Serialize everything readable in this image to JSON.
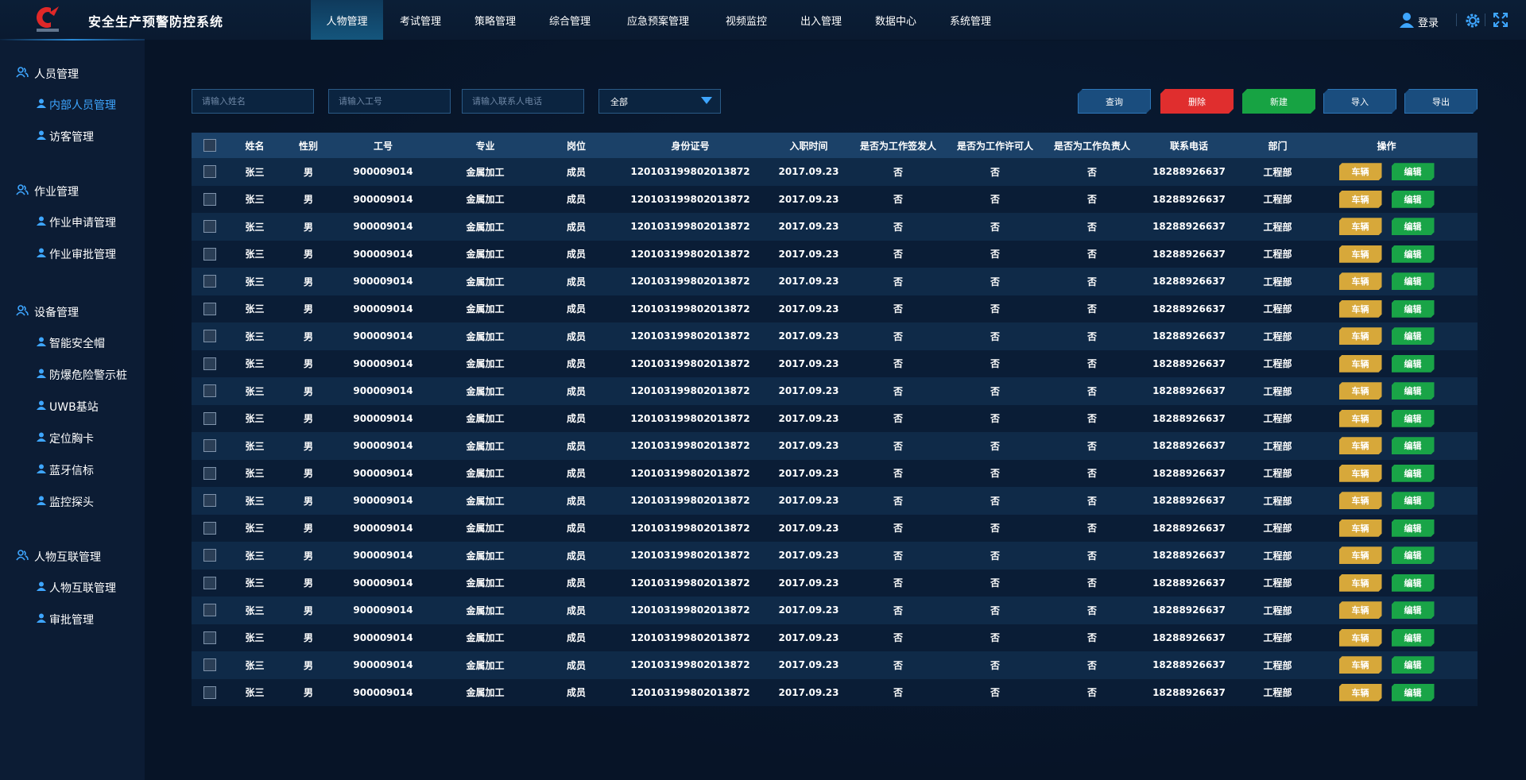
{
  "app": {
    "title": "安全生产预警防控系统"
  },
  "nav": [
    {
      "label": "人物管理",
      "active": true
    },
    {
      "label": "考试管理"
    },
    {
      "label": "策略管理"
    },
    {
      "label": "综合管理"
    },
    {
      "label": "应急预案管理"
    },
    {
      "label": "视频监控"
    },
    {
      "label": "出入管理"
    },
    {
      "label": "数据中心"
    },
    {
      "label": "系统管理"
    }
  ],
  "header": {
    "login_label": "登录"
  },
  "sidebar": {
    "groups": [
      {
        "label": "人员管理",
        "items": [
          {
            "label": "内部人员管理",
            "active": true
          },
          {
            "label": "访客管理"
          }
        ]
      },
      {
        "label": "作业管理",
        "items": [
          {
            "label": "作业申请管理"
          },
          {
            "label": "作业审批管理"
          }
        ]
      },
      {
        "label": "设备管理",
        "items": [
          {
            "label": "智能安全帽"
          },
          {
            "label": "防爆危险警示桩"
          },
          {
            "label": "UWB基站"
          },
          {
            "label": "定位胸卡"
          },
          {
            "label": "蓝牙信标"
          },
          {
            "label": "监控探头"
          }
        ]
      },
      {
        "label": "人物互联管理",
        "items": [
          {
            "label": "人物互联管理"
          },
          {
            "label": "审批管理"
          }
        ]
      }
    ]
  },
  "filters": {
    "name_placeholder": "请输入姓名",
    "id_placeholder": "请输入工号",
    "phone_placeholder": "请输入联系人电话",
    "select_value": "全部"
  },
  "buttons": {
    "query": "查询",
    "delete": "删除",
    "create": "新建",
    "import": "导入",
    "export": "导出"
  },
  "table": {
    "columns": [
      "",
      "姓名",
      "性别",
      "工号",
      "专业",
      "岗位",
      "身份证号",
      "入职时间",
      "是否为工作签发人",
      "是否为工作许可人",
      "是否为工作负责人",
      "联系电话",
      "部门",
      "操作"
    ],
    "row_template": {
      "name": "张三",
      "gender": "男",
      "emp_id": "900009014",
      "major": "金属加工",
      "post": "成员",
      "id_card": "120103199802013872",
      "join_date": "2017.09.23",
      "signer": "否",
      "permitter": "否",
      "leader": "否",
      "phone": "18288926637",
      "dept": "工程部"
    },
    "row_count": 20,
    "actions": {
      "car": "车辆",
      "edit": "编辑"
    }
  },
  "colors": {
    "background": "#071427",
    "accent": "#3ea6ff",
    "delete": "#e02e2e",
    "create": "#17a343",
    "car_button": "#d7a83a",
    "edit_button": "#19a447",
    "header_row": "#1b4168"
  }
}
